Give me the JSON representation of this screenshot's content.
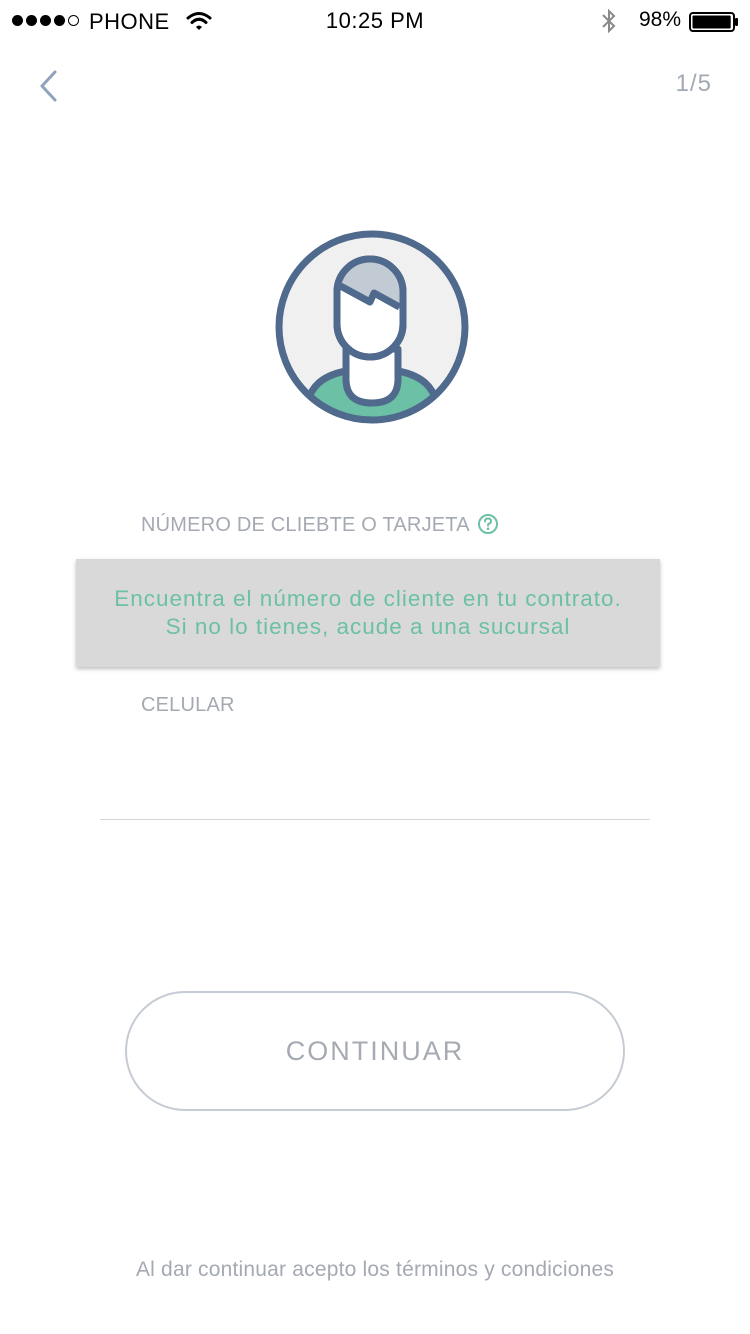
{
  "status_bar": {
    "carrier": "PHONE",
    "time": "10:25 PM",
    "battery": "98%",
    "battery_level": 0.98,
    "signal_bars_filled": 4,
    "signal_bars_total": 5
  },
  "nav": {
    "step": "1/5",
    "back_icon": "chevron-left-icon"
  },
  "avatar": {
    "icon": "user-avatar-icon",
    "colors": {
      "outline": "#4f6a8c",
      "background": "#f0f0f1",
      "hair": "#c2cbd3",
      "shirt": "#6cc0a5"
    }
  },
  "form": {
    "card_label": "NÚMERO DE CLIEBTE O TARJETA",
    "help_icon": "question-circle-icon",
    "tooltip_line1": "Encuentra el número de cliente en tu contrato.",
    "tooltip_line2": "Si no lo tienes, acude a una sucursal",
    "phone_label": "CELULAR",
    "phone_value": ""
  },
  "continue_label": "CONTINUAR",
  "terms_text": "Al dar continuar acepto los términos y condiciones",
  "colors": {
    "accent": "#6cc0a5",
    "muted_text": "#a4a9b2",
    "tooltip_bg": "#d9d9d9",
    "button_border": "#c6ccd3"
  }
}
